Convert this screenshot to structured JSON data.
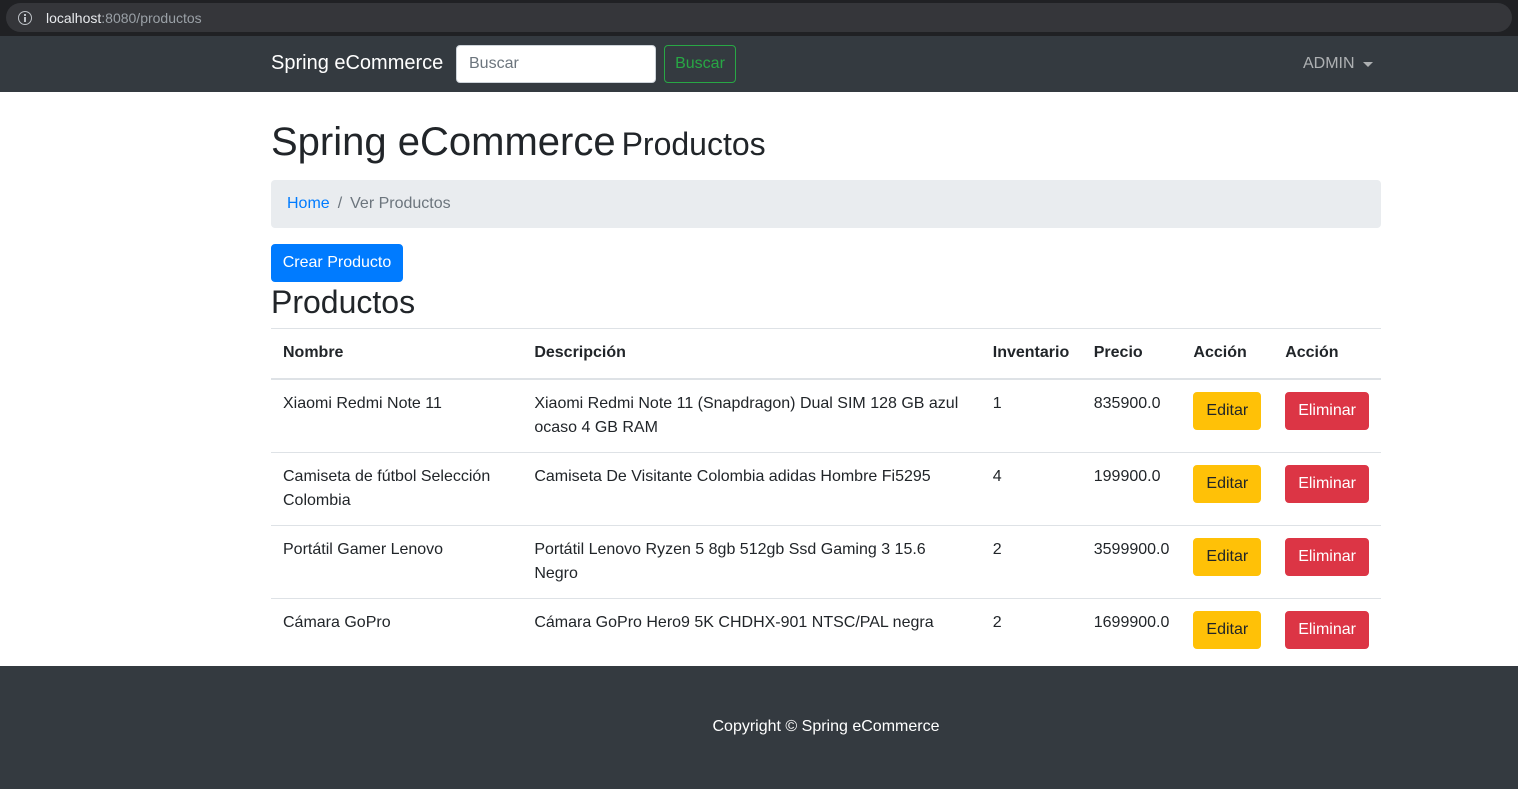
{
  "browser": {
    "url_host": "localhost",
    "url_rest": ":8080/productos"
  },
  "navbar": {
    "brand": "Spring eCommerce",
    "search_placeholder": "Buscar",
    "search_button": "Buscar",
    "user_menu": "ADMIN"
  },
  "page": {
    "title": "Spring eCommerce",
    "subtitle": "Productos",
    "breadcrumb": {
      "home": "Home",
      "separator": "/",
      "current": "Ver Productos"
    },
    "create_button": "Crear Producto",
    "section_title": "Productos"
  },
  "table": {
    "headers": [
      "Nombre",
      "Descripción",
      "Inventario",
      "Precio",
      "Acción",
      "Acción"
    ],
    "rows": [
      {
        "nombre": "Xiaomi Redmi Note 11",
        "descripcion": "Xiaomi Redmi Note 11 (Snapdragon) Dual SIM 128 GB azul ocaso 4 GB RAM",
        "inventario": "1",
        "precio": "835900.0",
        "editar": "Editar",
        "eliminar": "Eliminar"
      },
      {
        "nombre": "Camiseta de fútbol Selección Colombia",
        "descripcion": "Camiseta De Visitante Colombia adidas Hombre Fi5295",
        "inventario": "4",
        "precio": "199900.0",
        "editar": "Editar",
        "eliminar": "Eliminar"
      },
      {
        "nombre": "Portátil Gamer Lenovo",
        "descripcion": "Portátil Lenovo Ryzen 5 8gb 512gb Ssd Gaming 3 15.6 Negro",
        "inventario": "2",
        "precio": "3599900.0",
        "editar": "Editar",
        "eliminar": "Eliminar"
      },
      {
        "nombre": "Cámara GoPro",
        "descripcion": "Cámara GoPro Hero9 5K CHDHX-901 NTSC/PAL negra",
        "inventario": "2",
        "precio": "1699900.0",
        "editar": "Editar",
        "eliminar": "Eliminar"
      }
    ]
  },
  "footer": {
    "copyright": "Copyright © Spring eCommerce"
  },
  "colors": {
    "navbar": "#343a40",
    "primary": "#007bff",
    "warning": "#ffc107",
    "danger": "#dc3545",
    "success": "#28a745",
    "breadcrumb_bg": "#e9ecef"
  }
}
